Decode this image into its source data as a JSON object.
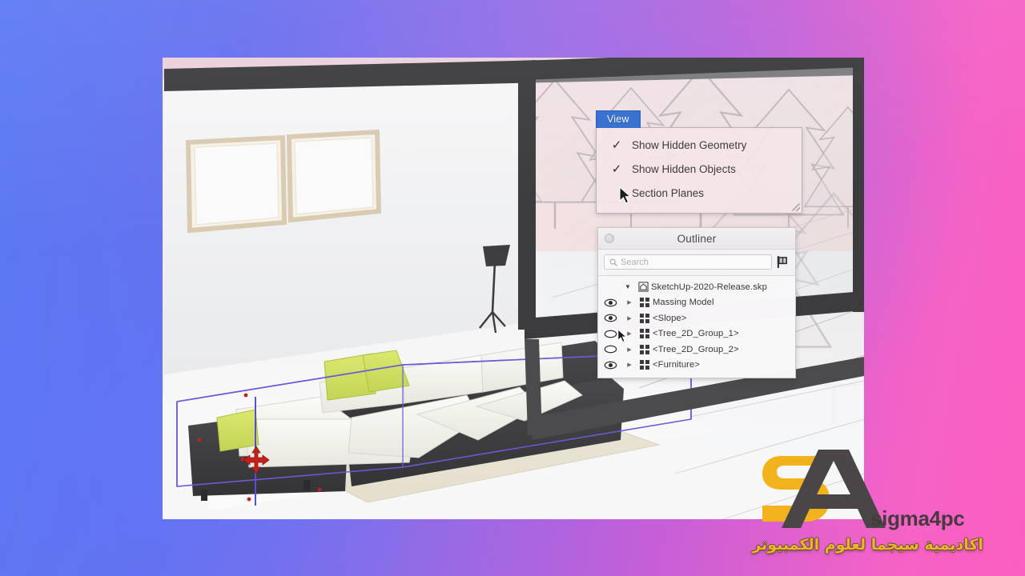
{
  "app": {
    "screenshot_title": "SketchUp 2020 Outliner hidden objects"
  },
  "background": {
    "gradient_from": "#5a79f4",
    "gradient_mid": "#8a6de8",
    "gradient_to": "#fb5fc0"
  },
  "view_menu": {
    "tab_label": "View",
    "accent_color": "#3a72d2",
    "items": [
      {
        "label": "Show Hidden Geometry",
        "checked": true,
        "check_glyph": "✓"
      },
      {
        "label": "Show Hidden Objects",
        "checked": true,
        "check_glyph": "✓"
      },
      {
        "label": "Section Planes",
        "checked": false,
        "check_glyph": ""
      }
    ]
  },
  "outliner": {
    "title": "Outliner",
    "search": {
      "placeholder": "Search",
      "value": "",
      "icon": "search-icon"
    },
    "filter_icon": "filter-flag-icon",
    "root": {
      "label": "SketchUp-2020-Release.skp",
      "expanded": true,
      "expand_glyph": "▼",
      "icon": "model-home-icon"
    },
    "items": [
      {
        "label": "Massing Model",
        "visible": true,
        "expand_glyph": "▶",
        "icon": "component-icon"
      },
      {
        "label": "<Slope>",
        "visible": true,
        "expand_glyph": "▶",
        "icon": "component-icon"
      },
      {
        "label": "<Tree_2D_Group_1>",
        "visible": false,
        "expand_glyph": "▶",
        "icon": "component-icon"
      },
      {
        "label": "<Tree_2D_Group_2>",
        "visible": false,
        "expand_glyph": "▶",
        "icon": "component-icon"
      },
      {
        "label": "<Furniture>",
        "visible": true,
        "expand_glyph": "▶",
        "icon": "component-icon"
      }
    ]
  },
  "viewport": {
    "selection_color": "#6a5ad8",
    "move_cursor_color": "#c4201c",
    "scene_description": "Interior living room with sofa, rug, floor lamp, framed windows and snowy pine forest outside glass wall"
  },
  "watermark": {
    "brand": "sigma4pc",
    "arabic": "اكاديمية سيجما لعلوم الكمبيوتر",
    "logo_yellow": "#f2b21c",
    "logo_dark": "#4a4547"
  }
}
